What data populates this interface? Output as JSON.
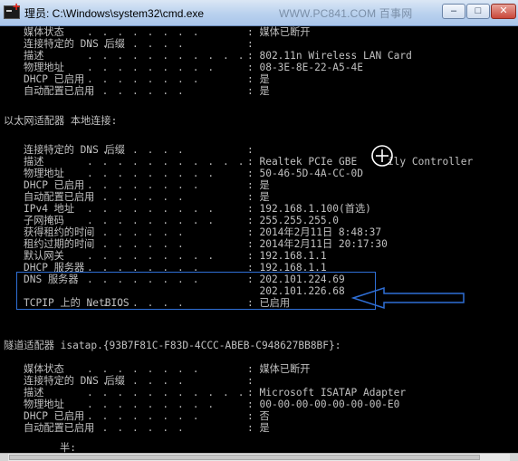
{
  "window": {
    "title": "理员: C:\\Windows\\system32\\cmd.exe",
    "watermark": "WWW.PC841.COM 百事网",
    "min_label": "–",
    "max_label": "□",
    "close_label": "✕"
  },
  "console": {
    "wireless": {
      "rows": [
        {
          "label": "媒体状态",
          "dots": ". . . . . . . .",
          "value": ": 媒体已断开"
        },
        {
          "label": "连接特定的 DNS 后缀",
          "dots": ". . . . . . .",
          "value": ":"
        },
        {
          "label": "描述",
          "dots": ". . . . . . . . . . .",
          "value": ": 802.11n Wireless LAN Card"
        },
        {
          "label": "物理地址",
          "dots": ". . . . . . . . .",
          "value": ": 08-3E-8E-22-A5-4E"
        },
        {
          "label": "DHCP 已启用",
          "dots": ". . . . . . . .",
          "value": ": 是"
        },
        {
          "label": "自动配置已启用",
          "dots": ". . . . . . .",
          "value": ": 是"
        }
      ]
    },
    "ethernet": {
      "heading": "以太网适配器 本地连接:",
      "rows": [
        {
          "label": "连接特定的 DNS 后缀",
          "dots": ". . . . . . .",
          "value": ":"
        },
        {
          "label": "描述",
          "dots": ". . . . . . . . . . .",
          "value": ": Realtek PCIe GBE     ily Controller"
        },
        {
          "label": "物理地址",
          "dots": ". . . . . . . . .",
          "value": ": 50-46-5D-4A-CC-0D"
        },
        {
          "label": "DHCP 已启用",
          "dots": ". . . . . . . .",
          "value": ": 是"
        },
        {
          "label": "自动配置已启用",
          "dots": ". . . . . . .",
          "value": ": 是"
        },
        {
          "label": "IPv4 地址",
          "dots": ". . . . . . . . .",
          "value": ": 192.168.1.100(首选)"
        },
        {
          "label": "子网掩码",
          "dots": ". . . . . . . . .",
          "value": ": 255.255.255.0"
        },
        {
          "label": "获得租约的时间",
          "dots": ". . . . . . .",
          "value": ": 2014年2月11日 8:48:37"
        },
        {
          "label": "租约过期的时间",
          "dots": ". . . . . . .",
          "value": ": 2014年2月11日 20:17:30"
        },
        {
          "label": "默认网关",
          "dots": ". . . . . . . . .",
          "value": ": 192.168.1.1"
        },
        {
          "label": "DHCP 服务器",
          "dots": ". . . . . . . .",
          "value": ": 192.168.1.1"
        },
        {
          "label": "DNS 服务器",
          "dots": ". . . . . . . .",
          "value": ": 202.101.224.69"
        },
        {
          "label": "",
          "dots": "",
          "value": "  202.101.226.68"
        },
        {
          "label": "TCPIP 上的 NetBIOS",
          "dots": ". . . . . . .",
          "value": ": 已启用"
        }
      ]
    },
    "tunnel": {
      "heading": "隧道适配器 isatap.{93B7F81C-F83D-4CCC-ABEB-C948627BB8BF}:",
      "rows": [
        {
          "label": "媒体状态",
          "dots": ". . . . . . . .",
          "value": ": 媒体已断开"
        },
        {
          "label": "连接特定的 DNS 后缀",
          "dots": ". . . . . . .",
          "value": ":"
        },
        {
          "label": "描述",
          "dots": ". . . . . . . . . . .",
          "value": ": Microsoft ISATAP Adapter"
        },
        {
          "label": "物理地址",
          "dots": ". . . . . . . . .",
          "value": ": 00-00-00-00-00-00-00-E0"
        },
        {
          "label": "DHCP 已启用",
          "dots": ". . . . . . . .",
          "value": ": 否"
        },
        {
          "label": "自动配置已启用",
          "dots": ". . . . . . .",
          "value": ": 是"
        }
      ]
    },
    "prompt_fragment": "半:"
  },
  "colors": {
    "console_text": "#c0c0c0",
    "console_bg": "#000000",
    "highlight": "#2f6fd6"
  },
  "icons": [
    "cmd-app-icon",
    "plus-badge-icon",
    "crosshair-cursor-icon",
    "pointer-arrow-icon"
  ]
}
